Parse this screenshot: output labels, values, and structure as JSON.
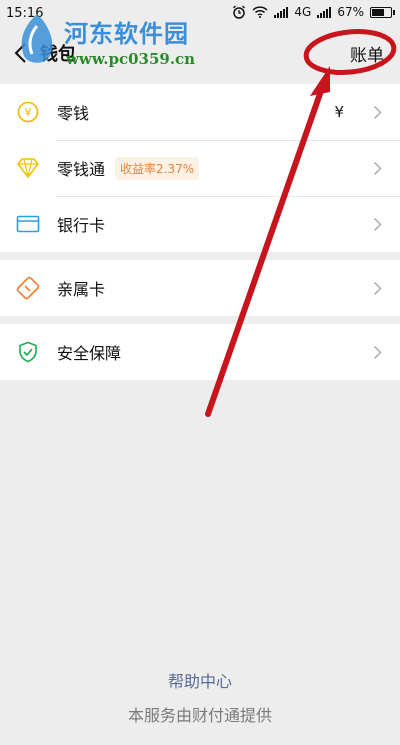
{
  "status_bar": {
    "time": "15:16",
    "network": "4G",
    "battery": "67%"
  },
  "header": {
    "title": "钱包",
    "bill_label": "账单"
  },
  "watermark": {
    "title": "河东软件园",
    "url": "www.pc0359.cn"
  },
  "menu_group_1": [
    {
      "label": "零钱",
      "icon": "yen-icon",
      "value": "¥"
    },
    {
      "label": "零钱通",
      "icon": "diamond-icon",
      "badge": "收益率2.37%"
    },
    {
      "label": "银行卡",
      "icon": "bank-card-icon"
    }
  ],
  "menu_group_2": [
    {
      "label": "亲属卡",
      "icon": "family-card-icon"
    }
  ],
  "menu_group_3": [
    {
      "label": "安全保障",
      "icon": "shield-icon"
    }
  ],
  "footer": {
    "help_link": "帮助中心",
    "provider_note": "本服务由财付通提供"
  },
  "colors": {
    "accent_link": "#576b95",
    "annotation_red": "#c8141c",
    "badge_orange": "#e2853b"
  }
}
